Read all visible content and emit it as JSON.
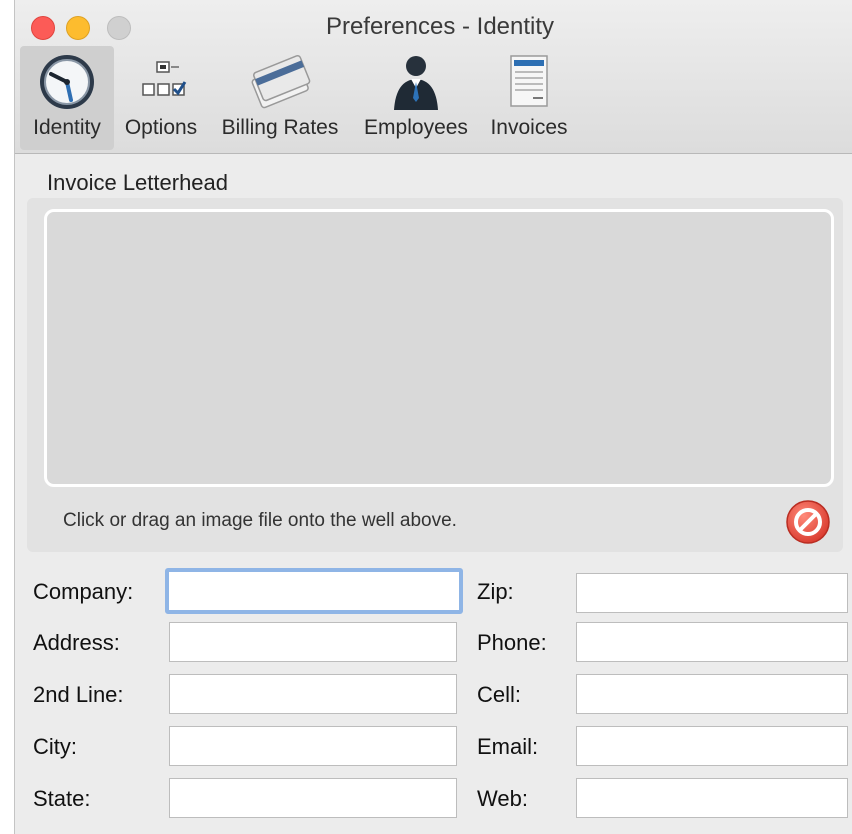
{
  "window": {
    "title": "Preferences - Identity"
  },
  "toolbar": {
    "items": [
      {
        "label": "Identity",
        "icon": "identity-clock-icon",
        "selected": true
      },
      {
        "label": "Options",
        "icon": "options-checkbox-icon"
      },
      {
        "label": "Billing Rates",
        "icon": "billing-cards-icon"
      },
      {
        "label": "Employees",
        "icon": "employee-person-icon"
      },
      {
        "label": "Invoices",
        "icon": "invoice-document-icon"
      }
    ]
  },
  "letterhead": {
    "title": "Invoice Letterhead",
    "hint": "Click or drag an image file onto the well above."
  },
  "form": {
    "left": [
      {
        "label": "Company:",
        "value": ""
      },
      {
        "label": "Address:",
        "value": ""
      },
      {
        "label": "2nd Line:",
        "value": ""
      },
      {
        "label": "City:",
        "value": ""
      },
      {
        "label": "State:",
        "value": ""
      }
    ],
    "right": [
      {
        "label": "Zip:",
        "value": ""
      },
      {
        "label": "Phone:",
        "value": ""
      },
      {
        "label": "Cell:",
        "value": ""
      },
      {
        "label": "Email:",
        "value": ""
      },
      {
        "label": "Web:",
        "value": ""
      }
    ]
  },
  "colors": {
    "close": "#fc5b57",
    "minimize": "#fdbc2e",
    "zoom": "#d0d0d0",
    "focus_ring": "#8fb5e6",
    "clear_button": "#e8463a"
  }
}
